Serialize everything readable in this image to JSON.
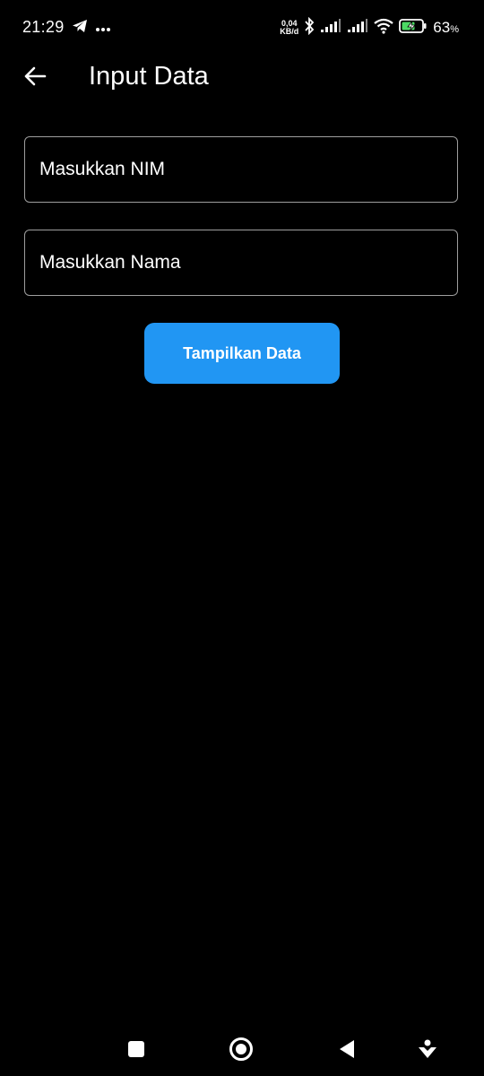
{
  "status_bar": {
    "time": "21:29",
    "net_speed_value": "0,04",
    "net_speed_unit": "KB/d",
    "battery_percent": "63",
    "battery_unit": "%",
    "icons": [
      "telegram-icon",
      "more-dots-icon",
      "bluetooth-icon",
      "signal-icon",
      "signal-icon",
      "wifi-icon",
      "battery-charging-icon"
    ]
  },
  "app_bar": {
    "title": "Input Data",
    "back_icon": "arrow-left-icon"
  },
  "form": {
    "nim_placeholder": "Masukkan NIM",
    "nim_value": "",
    "nama_placeholder": "Masukkan Nama",
    "nama_value": "",
    "submit_label": "Tampilkan Data"
  },
  "nav_bar": {
    "icons": [
      "recents-square-icon",
      "home-circle-icon",
      "back-triangle-icon",
      "assistant-icon"
    ]
  },
  "colors": {
    "background": "#000000",
    "accent": "#2196f3",
    "field_border": "#9e9e9e",
    "text": "#ffffff"
  }
}
